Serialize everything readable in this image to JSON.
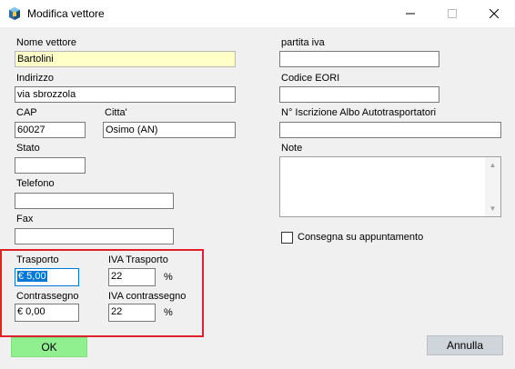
{
  "window": {
    "title": "Modifica vettore",
    "icon": "app-cube-icon"
  },
  "form": {
    "nome_label": "Nome vettore",
    "nome_value": "Bartolini",
    "indirizzo_label": "Indirizzo",
    "indirizzo_value": "via sbrozzola",
    "cap_label": "CAP",
    "cap_value": "60027",
    "citta_label": "Citta'",
    "citta_value": "Osimo (AN)",
    "stato_label": "Stato",
    "stato_value": "",
    "telefono_label": "Telefono",
    "telefono_value": "",
    "fax_label": "Fax",
    "fax_value": "",
    "piva_label": "partita iva",
    "piva_value": "",
    "eori_label": "Codice EORI",
    "eori_value": "",
    "albo_label": "N° Iscrizione Albo Autotrasportatori",
    "albo_value": "",
    "note_label": "Note",
    "note_value": "",
    "consegna_label": "Consegna su appuntamento",
    "consegna_checked": false
  },
  "costs": {
    "trasporto_label": "Trasporto",
    "trasporto_value": "€ 5,00",
    "iva_trasporto_label": "IVA Trasporto",
    "iva_trasporto_value": "22",
    "contrassegno_label": "Contrassegno",
    "contrassegno_value": "€ 0,00",
    "iva_contrassegno_label": "IVA contrassegno",
    "iva_contrassegno_value": "22",
    "percent": "%"
  },
  "buttons": {
    "ok": "OK",
    "cancel": "Annulla"
  },
  "colors": {
    "highlight": "#e0202a",
    "ok_bg": "#90f090",
    "yellow_field": "#ffffc8",
    "selection": "#0078d7"
  }
}
